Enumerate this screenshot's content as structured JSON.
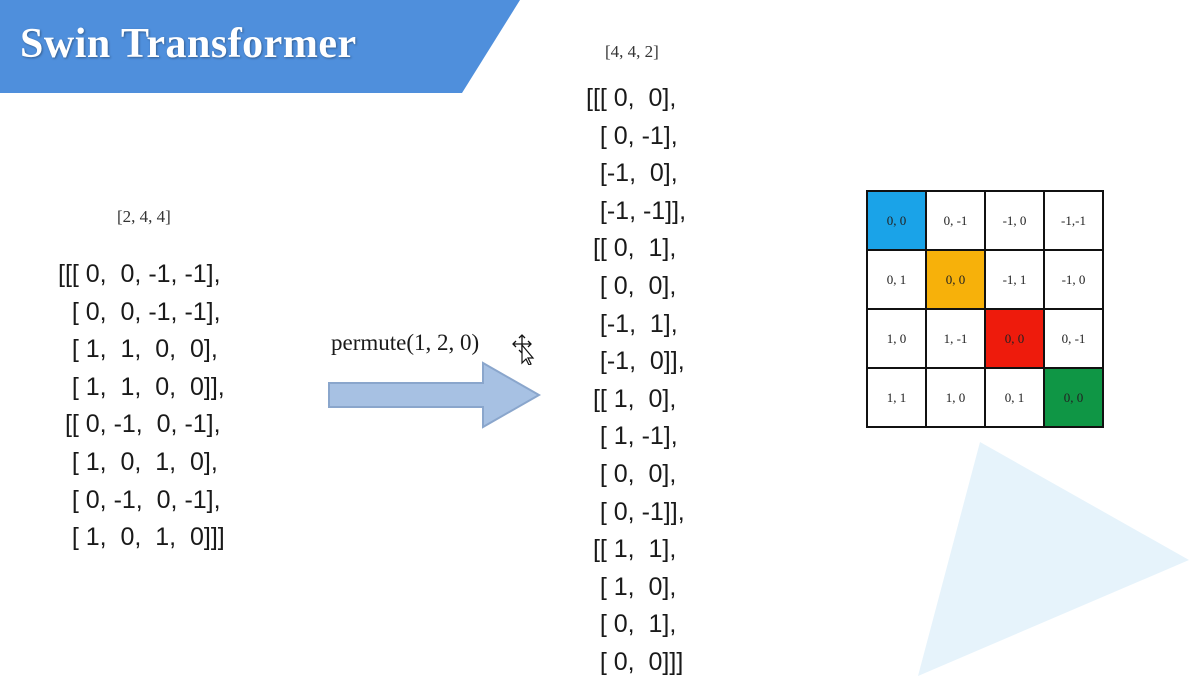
{
  "title": "Swin Transformer",
  "colors": {
    "banner": "#4f8fdc",
    "arrow_fill": "#a7c1e3",
    "arrow_stroke": "#8aa6cc",
    "deco_triangle": "#e6f3fb",
    "cell_blue": "#1aa3e8",
    "cell_orange": "#f7b10a",
    "cell_red": "#ee1b0c",
    "cell_green": "#0f9645"
  },
  "left": {
    "shape": "[2, 4, 4]",
    "lines": [
      "[[[ 0,  0, -1, -1],",
      "  [ 0,  0, -1, -1],",
      "  [ 1,  1,  0,  0],",
      "  [ 1,  1,  0,  0]],",
      " [[ 0, -1,  0, -1],",
      "  [ 1,  0,  1,  0],",
      "  [ 0, -1,  0, -1],",
      "  [ 1,  0,  1,  0]]]"
    ]
  },
  "operation": {
    "label": "permute(1, 2, 0)",
    "arrow_icon": "right-arrow-icon"
  },
  "right": {
    "shape": "[4, 4, 2]",
    "lines": [
      "[[[ 0,  0],",
      "  [ 0, -1],",
      "  [-1,  0],",
      "  [-1, -1]],",
      " [[ 0,  1],",
      "  [ 0,  0],",
      "  [-1,  1],",
      "  [-1,  0]],",
      " [[ 1,  0],",
      "  [ 1, -1],",
      "  [ 0,  0],",
      "  [ 0, -1]],",
      " [[ 1,  1],",
      "  [ 1,  0],",
      "  [ 0,  1],",
      "  [ 0,  0]]]"
    ]
  },
  "grid": {
    "rows": [
      [
        {
          "text": "0, 0",
          "color": "blue"
        },
        {
          "text": "0, -1"
        },
        {
          "text": "-1, 0"
        },
        {
          "text": "-1,-1"
        }
      ],
      [
        {
          "text": "0, 1"
        },
        {
          "text": "0, 0",
          "color": "orange"
        },
        {
          "text": "-1, 1"
        },
        {
          "text": "-1, 0"
        }
      ],
      [
        {
          "text": "1, 0"
        },
        {
          "text": "1, -1"
        },
        {
          "text": "0, 0",
          "color": "red"
        },
        {
          "text": "0, -1"
        }
      ],
      [
        {
          "text": "1, 1"
        },
        {
          "text": "1, 0"
        },
        {
          "text": "0, 1"
        },
        {
          "text": "0, 0",
          "color": "green"
        }
      ]
    ]
  }
}
